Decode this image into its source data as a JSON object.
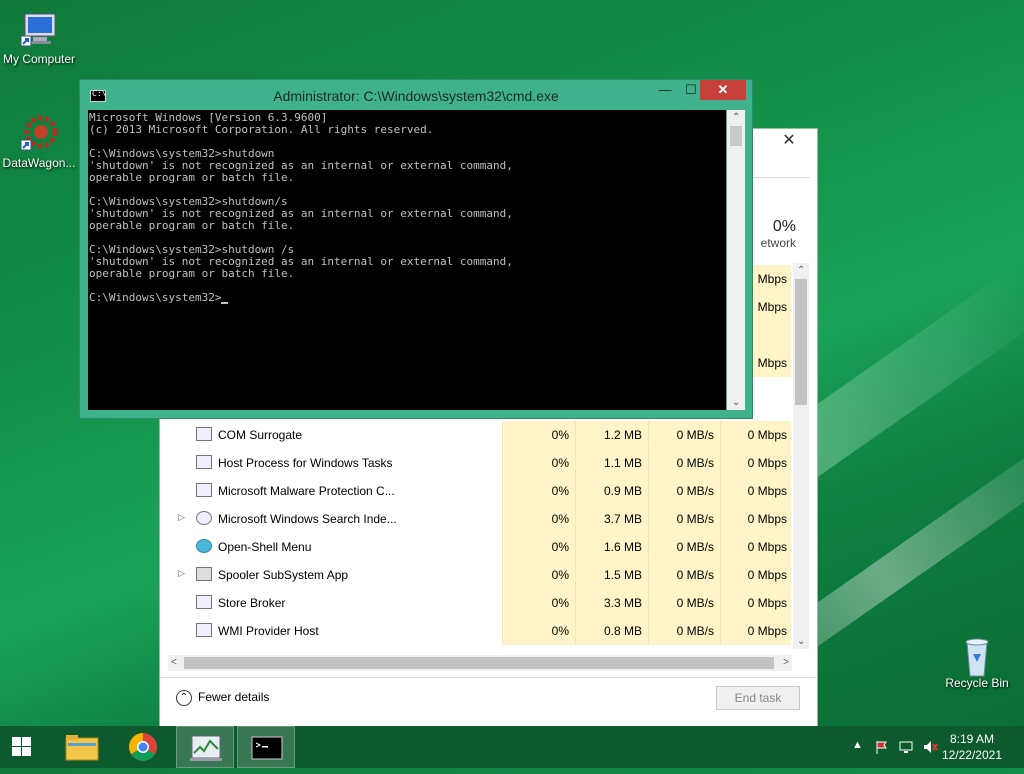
{
  "desktop": {
    "icons": [
      {
        "label": "My Computer",
        "icon": "computer-icon"
      },
      {
        "label": "DataWagon...",
        "icon": "gear-icon"
      },
      {
        "label": "Recycle Bin",
        "icon": "recycle-bin-icon"
      }
    ]
  },
  "cmd": {
    "title": "Administrator: C:\\Windows\\system32\\cmd.exe",
    "minimize": "—",
    "maximize": "☐",
    "close": "✕",
    "lines": [
      "Microsoft Windows [Version 6.3.9600]",
      "(c) 2013 Microsoft Corporation. All rights reserved.",
      "",
      "C:\\Windows\\system32>shutdown",
      "'shutdown' is not recognized as an internal or external command,",
      "operable program or batch file.",
      "",
      "C:\\Windows\\system32>shutdown/s",
      "'shutdown' is not recognized as an internal or external command,",
      "operable program or batch file.",
      "",
      "C:\\Windows\\system32>shutdown /s",
      "'shutdown' is not recognized as an internal or external command,",
      "operable program or batch file.",
      "",
      "C:\\Windows\\system32>"
    ]
  },
  "taskmgr": {
    "close": "✕",
    "network_pct": "0%",
    "network_label": "etwork",
    "upper_rows": [
      "Mbps",
      "Mbps",
      "",
      "Mbps"
    ],
    "rows": [
      {
        "name": "COM Surrogate",
        "expand": "",
        "cpu": "0%",
        "mem": "1.2 MB",
        "disk": "0 MB/s",
        "net": "0 Mbps"
      },
      {
        "name": "Host Process for Windows Tasks",
        "expand": "",
        "cpu": "0%",
        "mem": "1.1 MB",
        "disk": "0 MB/s",
        "net": "0 Mbps"
      },
      {
        "name": "Microsoft Malware Protection C...",
        "expand": "",
        "cpu": "0%",
        "mem": "0.9 MB",
        "disk": "0 MB/s",
        "net": "0 Mbps"
      },
      {
        "name": "Microsoft Windows Search Inde...",
        "expand": "▷",
        "cpu": "0%",
        "mem": "3.7 MB",
        "disk": "0 MB/s",
        "net": "0 Mbps"
      },
      {
        "name": "Open-Shell Menu",
        "expand": "",
        "cpu": "0%",
        "mem": "1.6 MB",
        "disk": "0 MB/s",
        "net": "0 Mbps"
      },
      {
        "name": "Spooler SubSystem App",
        "expand": "▷",
        "cpu": "0%",
        "mem": "1.5 MB",
        "disk": "0 MB/s",
        "net": "0 Mbps"
      },
      {
        "name": "Store Broker",
        "expand": "",
        "cpu": "0%",
        "mem": "3.3 MB",
        "disk": "0 MB/s",
        "net": "0 Mbps"
      },
      {
        "name": "WMI Provider Host",
        "expand": "",
        "cpu": "0%",
        "mem": "0.8 MB",
        "disk": "0 MB/s",
        "net": "0 Mbps"
      }
    ],
    "fewer_details": "Fewer details",
    "fewer_icon": "⌃",
    "end_task": "End task"
  },
  "taskbar": {
    "time": "8:19 AM",
    "date": "12/22/2021",
    "tray_chevron": "▲"
  }
}
